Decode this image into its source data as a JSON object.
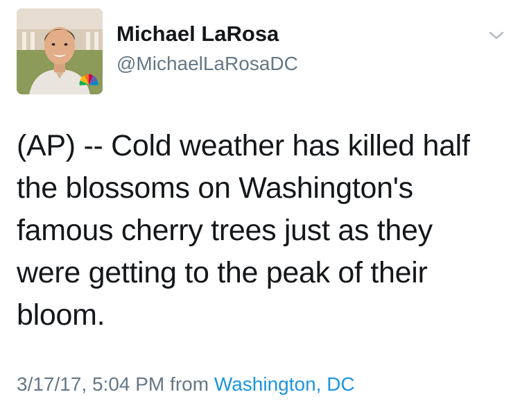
{
  "author": {
    "display_name": "Michael LaRosa",
    "handle": "@MichaelLaRosaDC",
    "avatar_icon": "profile-photo",
    "badge_icon": "nbc-peacock-icon"
  },
  "tweet": {
    "text_lines": [
      "(AP) -- Cold weather has killed half",
      "the blossoms on Washington's",
      "famous cherry trees just as they",
      "were getting to the peak of their",
      "bloom."
    ]
  },
  "meta": {
    "timestamp": "3/17/17, 5:04 PM",
    "from_label": "from",
    "location": "Washington, DC"
  },
  "menu": {
    "icon": "chevron-down-icon"
  },
  "colors": {
    "text": "#14171a",
    "secondary": "#657786",
    "link": "#1b95e0"
  }
}
